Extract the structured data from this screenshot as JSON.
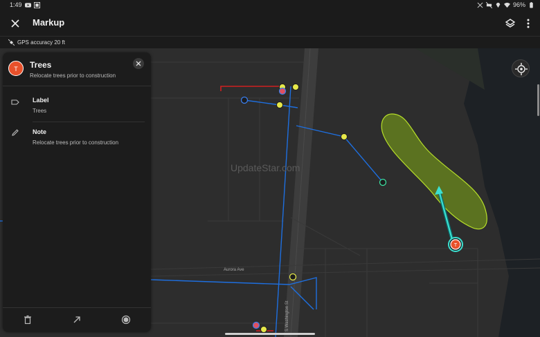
{
  "status_bar": {
    "time": "1:49",
    "battery": "96%",
    "left_icons": [
      "youtube-icon",
      "gallery-icon"
    ],
    "right_icons": [
      "no-signal-icon",
      "mute-icon",
      "location-icon",
      "wifi-icon",
      "battery-icon"
    ]
  },
  "app_bar": {
    "title": "Markup",
    "close_icon": "close-icon",
    "layers_icon": "layers-icon",
    "more_icon": "more-vert-icon"
  },
  "gps": {
    "text": "GPS accuracy 20 ft",
    "icon": "satellite-icon"
  },
  "panel": {
    "avatar_letter": "T",
    "title": "Trees",
    "subtitle": "Relocate trees prior to construction",
    "fields": [
      {
        "label": "Label",
        "value": "Trees",
        "icon": "tag-icon"
      },
      {
        "label": "Note",
        "value": "Relocate trees prior to construction",
        "icon": "pencil-icon"
      }
    ],
    "footer_icons": [
      "delete-icon",
      "arrow-icon",
      "record-icon"
    ]
  },
  "map": {
    "watermark": "UpdateStar.com",
    "roads": [
      "Aurora Ave",
      "S Washington St"
    ],
    "markup_color": "#e8512b",
    "polygon_color": "#7a9a1e",
    "utility_color": "#1e6fe0"
  }
}
